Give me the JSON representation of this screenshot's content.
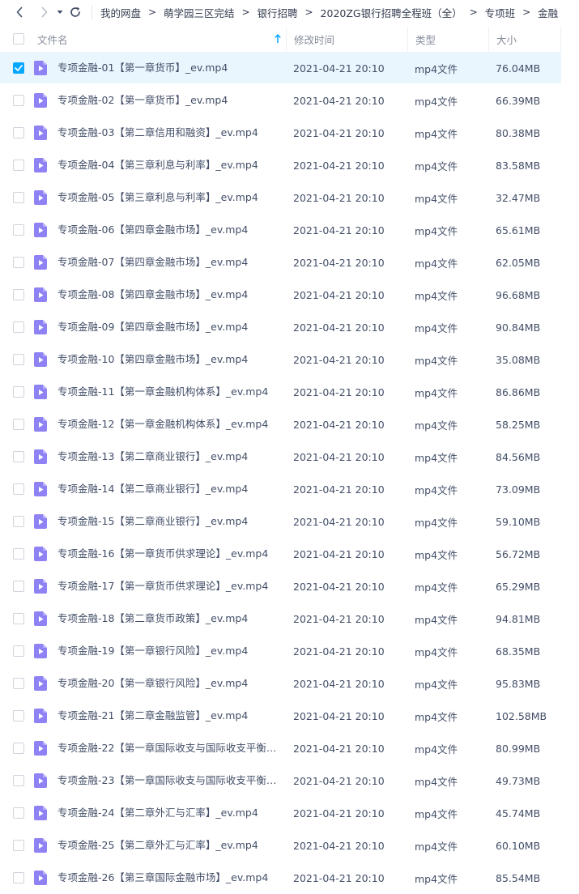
{
  "nav": {
    "back_icon": "chevron-left-icon",
    "forward_icon": "chevron-right-icon",
    "history_icon": "caret-down-icon",
    "refresh_icon": "refresh-icon",
    "breadcrumbs": [
      "我的网盘",
      "萌学园三区完结",
      "银行招聘",
      "2020ZG银行招聘全程班（全）",
      "专项班",
      "金融"
    ],
    "separator": ">"
  },
  "columns": {
    "name": "文件名",
    "modified": "修改时间",
    "type": "类型",
    "size": "大小",
    "sort_icon": "arrow-up-icon"
  },
  "colors": {
    "accent": "#06a7ff",
    "selected_row": "#eaf6fe",
    "file_icon": "#8e82f5"
  },
  "files": [
    {
      "name": "专项金融-01【第一章货币】_ev.mp4",
      "modified": "2021-04-21 20:10",
      "type": "mp4文件",
      "size": "76.04MB",
      "selected": true
    },
    {
      "name": "专项金融-02【第一章货币】_ev.mp4",
      "modified": "2021-04-21 20:10",
      "type": "mp4文件",
      "size": "66.39MB",
      "selected": false
    },
    {
      "name": "专项金融-03【第二章信用和融资】_ev.mp4",
      "modified": "2021-04-21 20:10",
      "type": "mp4文件",
      "size": "80.38MB",
      "selected": false
    },
    {
      "name": "专项金融-04【第三章利息与利率】_ev.mp4",
      "modified": "2021-04-21 20:10",
      "type": "mp4文件",
      "size": "83.58MB",
      "selected": false
    },
    {
      "name": "专项金融-05【第三章利息与利率】_ev.mp4",
      "modified": "2021-04-21 20:10",
      "type": "mp4文件",
      "size": "32.47MB",
      "selected": false
    },
    {
      "name": "专项金融-06【第四章金融市场】_ev.mp4",
      "modified": "2021-04-21 20:10",
      "type": "mp4文件",
      "size": "65.61MB",
      "selected": false
    },
    {
      "name": "专项金融-07【第四章金融市场】_ev.mp4",
      "modified": "2021-04-21 20:10",
      "type": "mp4文件",
      "size": "62.05MB",
      "selected": false
    },
    {
      "name": "专项金融-08【第四章金融市场】_ev.mp4",
      "modified": "2021-04-21 20:10",
      "type": "mp4文件",
      "size": "96.68MB",
      "selected": false
    },
    {
      "name": "专项金融-09【第四章金融市场】_ev.mp4",
      "modified": "2021-04-21 20:10",
      "type": "mp4文件",
      "size": "90.84MB",
      "selected": false
    },
    {
      "name": "专项金融-10【第四章金融市场】_ev.mp4",
      "modified": "2021-04-21 20:10",
      "type": "mp4文件",
      "size": "35.08MB",
      "selected": false
    },
    {
      "name": "专项金融-11【第一章金融机构体系】_ev.mp4",
      "modified": "2021-04-21 20:10",
      "type": "mp4文件",
      "size": "86.86MB",
      "selected": false
    },
    {
      "name": "专项金融-12【第一章金融机构体系】_ev.mp4",
      "modified": "2021-04-21 20:10",
      "type": "mp4文件",
      "size": "58.25MB",
      "selected": false
    },
    {
      "name": "专项金融-13【第二章商业银行】_ev.mp4",
      "modified": "2021-04-21 20:10",
      "type": "mp4文件",
      "size": "84.56MB",
      "selected": false
    },
    {
      "name": "专项金融-14【第二章商业银行】_ev.mp4",
      "modified": "2021-04-21 20:10",
      "type": "mp4文件",
      "size": "73.09MB",
      "selected": false
    },
    {
      "name": "专项金融-15【第二章商业银行】_ev.mp4",
      "modified": "2021-04-21 20:10",
      "type": "mp4文件",
      "size": "59.10MB",
      "selected": false
    },
    {
      "name": "专项金融-16【第一章货币供求理论】_ev.mp4",
      "modified": "2021-04-21 20:10",
      "type": "mp4文件",
      "size": "56.72MB",
      "selected": false
    },
    {
      "name": "专项金融-17【第一章货币供求理论】_ev.mp4",
      "modified": "2021-04-21 20:10",
      "type": "mp4文件",
      "size": "65.29MB",
      "selected": false
    },
    {
      "name": "专项金融-18【第二章货币政策】_ev.mp4",
      "modified": "2021-04-21 20:10",
      "type": "mp4文件",
      "size": "94.81MB",
      "selected": false
    },
    {
      "name": "专项金融-19【第一章银行风险】_ev.mp4",
      "modified": "2021-04-21 20:10",
      "type": "mp4文件",
      "size": "68.35MB",
      "selected": false
    },
    {
      "name": "专项金融-20【第一章银行风险】_ev.mp4",
      "modified": "2021-04-21 20:10",
      "type": "mp4文件",
      "size": "95.83MB",
      "selected": false
    },
    {
      "name": "专项金融-21【第二章金融监管】_ev.mp4",
      "modified": "2021-04-21 20:10",
      "type": "mp4文件",
      "size": "102.58MB",
      "selected": false
    },
    {
      "name": "专项金融-22【第一章国际收支与国际收支平衡表...",
      "modified": "2021-04-21 20:10",
      "type": "mp4文件",
      "size": "80.99MB",
      "selected": false
    },
    {
      "name": "专项金融-23【第一章国际收支与国际收支平衡表...",
      "modified": "2021-04-21 20:10",
      "type": "mp4文件",
      "size": "49.73MB",
      "selected": false
    },
    {
      "name": "专项金融-24【第二章外汇与汇率】_ev.mp4",
      "modified": "2021-04-21 20:10",
      "type": "mp4文件",
      "size": "45.74MB",
      "selected": false
    },
    {
      "name": "专项金融-25【第二章外汇与汇率】_ev.mp4",
      "modified": "2021-04-21 20:10",
      "type": "mp4文件",
      "size": "60.10MB",
      "selected": false
    },
    {
      "name": "专项金融-26【第三章国际金融市场】_ev.mp4",
      "modified": "2021-04-21 20:10",
      "type": "mp4文件",
      "size": "85.54MB",
      "selected": false
    }
  ]
}
